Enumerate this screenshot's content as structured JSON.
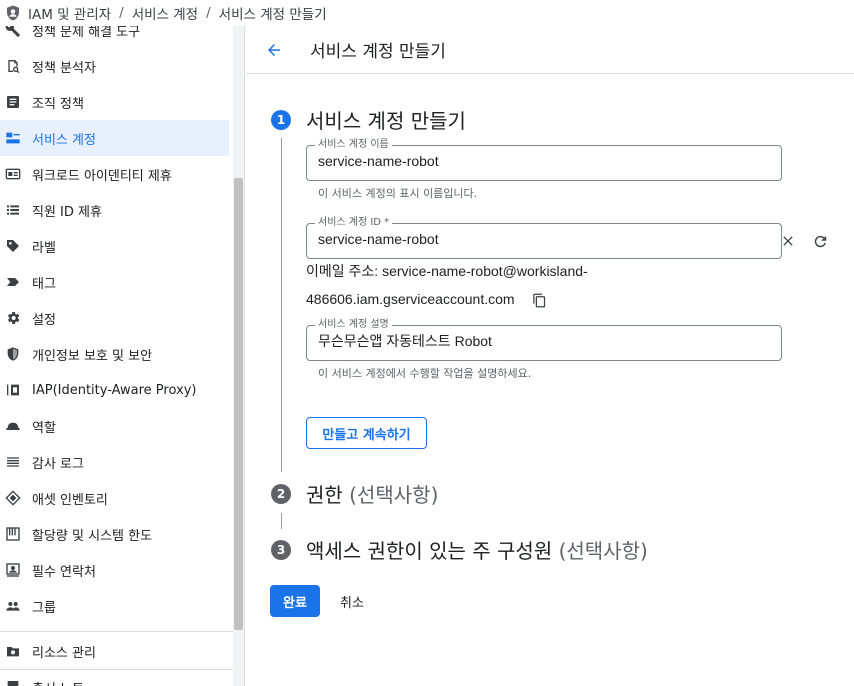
{
  "breadcrumb": {
    "items": [
      "IAM 및 관리자",
      "서비스 계정",
      "서비스 계정 만들기"
    ],
    "separator": "/"
  },
  "sidebar": {
    "items": [
      {
        "label": "정책 문제 해결 도구",
        "icon": "wrench-icon"
      },
      {
        "label": "정책 분석자",
        "icon": "policy-analyzer-icon"
      },
      {
        "label": "조직 정책",
        "icon": "document-list-icon"
      },
      {
        "label": "서비스 계정",
        "icon": "service-account-icon",
        "active": true
      },
      {
        "label": "워크로드 아이덴티티 제휴",
        "icon": "id-card-icon"
      },
      {
        "label": "직원 ID 제휴",
        "icon": "list-icon"
      },
      {
        "label": "라벨",
        "icon": "label-icon"
      },
      {
        "label": "태그",
        "icon": "tag-icon"
      },
      {
        "label": "설정",
        "icon": "gear-icon"
      },
      {
        "label": "개인정보 보호 및 보안",
        "icon": "shield-icon"
      },
      {
        "label": "IAP(Identity-Aware Proxy)",
        "icon": "iap-icon"
      },
      {
        "label": "역할",
        "icon": "hat-icon"
      },
      {
        "label": "감사 로그",
        "icon": "lines-icon"
      },
      {
        "label": "애셋 인벤토리",
        "icon": "diamond-icon"
      },
      {
        "label": "할당량 및 시스템 한도",
        "icon": "quota-icon"
      },
      {
        "label": "필수 연락처",
        "icon": "contact-icon"
      },
      {
        "label": "그룹",
        "icon": "group-icon"
      }
    ],
    "bottom_item": {
      "label": "리소스 관리",
      "icon": "resource-icon"
    },
    "partial_item": {
      "label": "출시 노트",
      "icon": "notes-icon"
    }
  },
  "header": {
    "title": "서비스 계정 만들기"
  },
  "steps": [
    {
      "num": "1",
      "title": "서비스 계정 만들기",
      "optional": ""
    },
    {
      "num": "2",
      "title": "권한",
      "optional": "(선택사항)"
    },
    {
      "num": "3",
      "title": "액세스 권한이 있는 주 구성원",
      "optional": "(선택사항)"
    }
  ],
  "form": {
    "name": {
      "label": "서비스 계정 이름",
      "value": "service-name-robot",
      "hint": "이 서비스 계정의 표시 이름입니다."
    },
    "id": {
      "label": "서비스 계정 ID *",
      "value": "service-name-robot"
    },
    "email": {
      "line1": "이메일 주소: service-name-robot@workisland-",
      "line2": "486606.iam.gserviceaccount.com"
    },
    "description": {
      "label": "서비스 계정 설명",
      "value": "무슨무슨앱 자동테스트 Robot",
      "hint": "이 서비스 계정에서 수행할 작업을 설명하세요."
    },
    "create_continue_label": "만들고 계속하기"
  },
  "actions": {
    "done_label": "완료",
    "cancel_label": "취소"
  },
  "colors": {
    "accent": "#1a73e8",
    "active_bg": "#e8f0fe",
    "text": "#202124",
    "muted": "#5f6368"
  }
}
